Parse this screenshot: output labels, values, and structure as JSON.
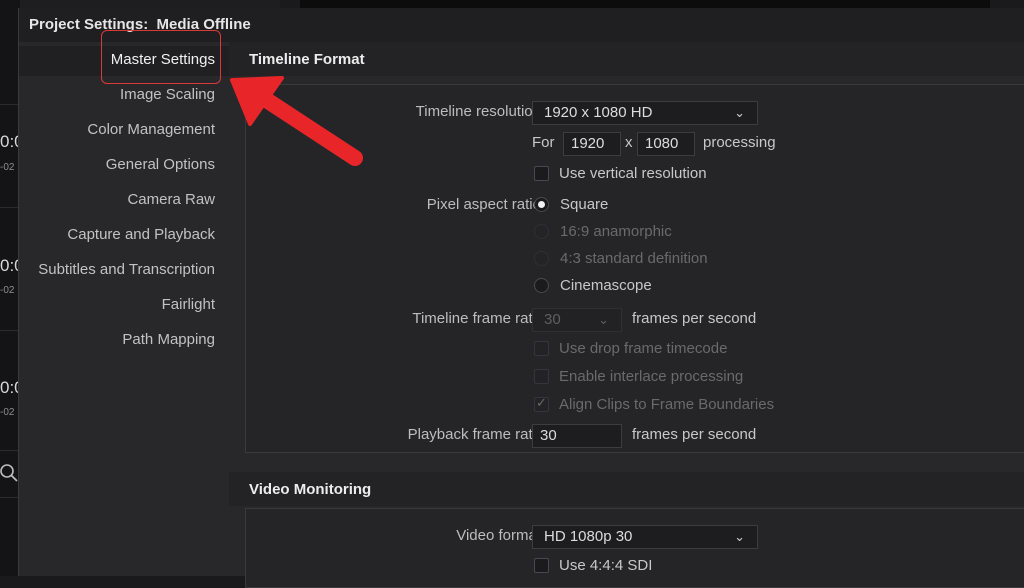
{
  "background_fragments": {
    "timecodes": [
      "0:0",
      "0:0",
      "0:0"
    ],
    "subs": [
      "-02",
      "-02",
      "-02"
    ]
  },
  "dialog": {
    "title": "Project Settings:  Media Offline"
  },
  "sidebar": {
    "items": [
      {
        "label": "Master Settings",
        "active": true
      },
      {
        "label": "Image Scaling"
      },
      {
        "label": "Color Management"
      },
      {
        "label": "General Options"
      },
      {
        "label": "Camera Raw"
      },
      {
        "label": "Capture and Playback"
      },
      {
        "label": "Subtitles and Transcription"
      },
      {
        "label": "Fairlight"
      },
      {
        "label": "Path Mapping"
      }
    ]
  },
  "timeline_format": {
    "title": "Timeline Format",
    "resolution_label": "Timeline resolution",
    "resolution_value": "1920 x 1080 HD",
    "for_label": "For",
    "width_value": "1920",
    "x_label": "x",
    "height_value": "1080",
    "processing_label": "processing",
    "vertical_label": "Use vertical resolution",
    "pixel_aspect_label": "Pixel aspect ratio",
    "pixel_aspect_options": [
      "Square",
      "16:9 anamorphic",
      "4:3 standard definition",
      "Cinemascope"
    ],
    "pixel_aspect_selected": "Square",
    "frame_rate_label": "Timeline frame rate",
    "frame_rate_value": "30",
    "fps_label": "frames per second",
    "drop_frame_label": "Use drop frame timecode",
    "interlace_label": "Enable interlace processing",
    "align_label": "Align Clips to Frame Boundaries",
    "playback_rate_label": "Playback frame rate",
    "playback_rate_value": "30",
    "playback_fps_label": "frames per second"
  },
  "video_monitoring": {
    "title": "Video Monitoring",
    "format_label": "Video format",
    "format_value": "HD 1080p 30",
    "sdi_label": "Use 4:4:4 SDI"
  },
  "colors": {
    "annotation": "#e8262a",
    "highlight_border": "#d83a3a"
  },
  "icons": {
    "search": "search-icon",
    "chevron": "chevron-down-icon",
    "arrow": "annotation-arrow"
  }
}
